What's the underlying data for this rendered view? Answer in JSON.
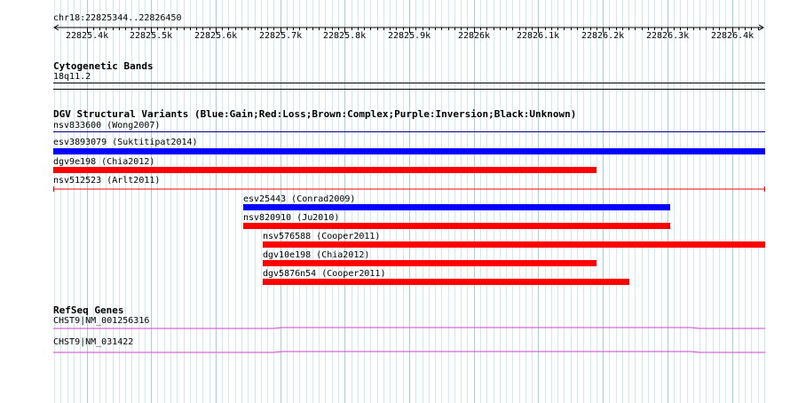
{
  "ruler": {
    "range_label": "chr18:22825344..22826450",
    "ticks": [
      "22825.4k",
      "22825.5k",
      "22825.6k",
      "22825.7k",
      "22825.8k",
      "22825.9k",
      "22826k",
      "22826.1k",
      "22826.2k",
      "22826.3k",
      "22826.4k"
    ]
  },
  "cytoband": {
    "title": "Cytogenetic Bands",
    "band": "18q11.2"
  },
  "dgv": {
    "title": "DGV Structural Variants (Blue:Gain;Red:Loss;Brown:Complex;Purple:Inversion;Black:Unknown)",
    "features": [
      {
        "label": "nsv833600 (Wong2007)",
        "type": "Unknown",
        "color": "#000080"
      },
      {
        "label": "esv3893079 (Suktitipat2014)",
        "type": "Gain",
        "color": "#0000ff"
      },
      {
        "label": "dgv9e198 (Chia2012)",
        "type": "Loss",
        "color": "#ff0000"
      },
      {
        "label": "nsv512523 (Arlt2011)",
        "type": "Loss",
        "color": "#ff0000"
      },
      {
        "label": "esv25443 (Conrad2009)",
        "type": "Gain",
        "color": "#0000ff"
      },
      {
        "label": "nsv820910 (Ju2010)",
        "type": "Loss",
        "color": "#ff0000"
      },
      {
        "label": "nsv576588 (Cooper2011)",
        "type": "Loss",
        "color": "#ff0000"
      },
      {
        "label": "dgv10e198 (Chia2012)",
        "type": "Loss",
        "color": "#ff0000"
      },
      {
        "label": "dgv5876n54 (Cooper2011)",
        "type": "Loss",
        "color": "#ff0000"
      }
    ]
  },
  "refseq": {
    "title": "RefSeq Genes",
    "genes": [
      {
        "label": "CHST9|NM_001256316",
        "color": "#cc44cc"
      },
      {
        "label": "CHST9|NM_031422",
        "color": "#cc44cc"
      }
    ]
  }
}
